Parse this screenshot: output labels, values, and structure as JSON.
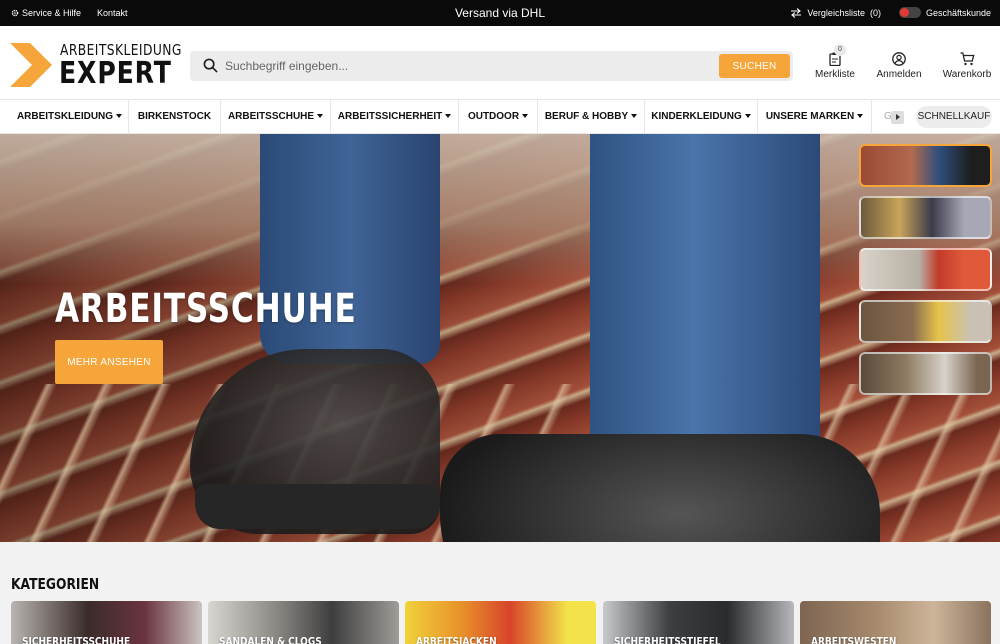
{
  "topbar": {
    "service": "Service & Hilfe",
    "contact": "Kontakt",
    "shipping": "Versand via DHL",
    "compare": "Vergleichsliste",
    "compare_count": "(0)",
    "business": "Geschäftskunde"
  },
  "logo": {
    "line1": "ARBEITSKLEIDUNG",
    "line2": "EXPERT"
  },
  "search": {
    "placeholder": "Suchbegriff eingeben...",
    "button": "SUCHEN"
  },
  "header_actions": {
    "wishlist": "Merkliste",
    "wishlist_count": "0",
    "login": "Anmelden",
    "cart": "Warenkorb"
  },
  "nav": {
    "items": [
      {
        "label": "ARBEITSKLEIDUNG",
        "dropdown": true
      },
      {
        "label": "BIRKENSTOCK",
        "dropdown": false
      },
      {
        "label": "ARBEITSSCHUHE",
        "dropdown": true
      },
      {
        "label": "ARBEITSSICHERHEIT",
        "dropdown": true
      },
      {
        "label": "OUTDOOR",
        "dropdown": true
      },
      {
        "label": "BERUF & HOBBY",
        "dropdown": true
      },
      {
        "label": "KINDERKLEIDUNG",
        "dropdown": true
      },
      {
        "label": "UNSERE MARKEN",
        "dropdown": true
      }
    ],
    "overflow": "G",
    "quick_buy": "SCHNELLKAUF"
  },
  "hero": {
    "title": "ARBEITSSCHUHE",
    "cta": "MEHR ANSEHEN"
  },
  "categories": {
    "title": "KATEGORIEN",
    "items": [
      {
        "label": "SICHERHEITSSCHUHE"
      },
      {
        "label": "SANDALEN & CLOGS"
      },
      {
        "label": "ARBEITSJACKEN"
      },
      {
        "label": "SICHERHEITSSTIEFEL"
      },
      {
        "label": "ARBEITSWESTEN"
      }
    ]
  },
  "colors": {
    "accent": "#f5a53a",
    "topbar": "#0a0a0a",
    "toggle_dot": "#e53935"
  }
}
